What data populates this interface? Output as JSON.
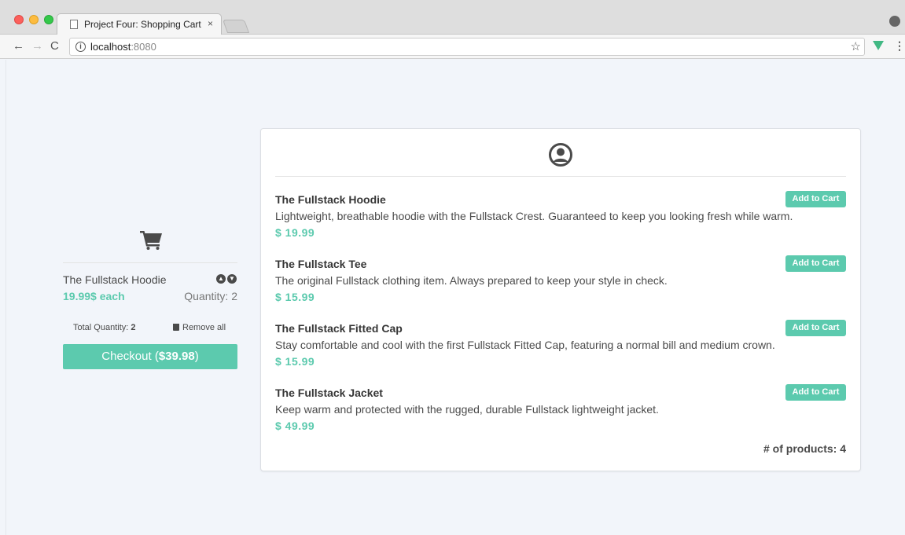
{
  "browser": {
    "tab_title": "Project Four: Shopping Cart",
    "tab_close": "×",
    "url_host": "localhost",
    "url_port": ":8080",
    "back_glyph": "←",
    "forward_glyph": "→",
    "reload_glyph": "C",
    "info_glyph": "i",
    "star_glyph": "☆",
    "menu_glyph": "⋮"
  },
  "cart": {
    "item_name": "The Fullstack Hoodie",
    "item_price": "19.99$ each",
    "item_quantity": "Quantity: 2",
    "total_quantity_label": "Total Quantity: ",
    "total_quantity_value": "2",
    "remove_all_label": "Remove all",
    "checkout_label": "Checkout (",
    "checkout_total": "$39.98",
    "checkout_close": ")"
  },
  "products": [
    {
      "title": "The Fullstack Hoodie",
      "description": "Lightweight, breathable hoodie with the Fullstack Crest. Guaranteed to keep you looking fresh while warm.",
      "price": "$ 19.99",
      "button": "Add to Cart"
    },
    {
      "title": "The Fullstack Tee",
      "description": "The original Fullstack clothing item. Always prepared to keep your style in check.",
      "price": "$ 15.99",
      "button": "Add to Cart"
    },
    {
      "title": "The Fullstack Fitted Cap",
      "description": "Stay comfortable and cool with the first Fullstack Fitted Cap, featuring a normal bill and medium crown.",
      "price": "$ 15.99",
      "button": "Add to Cart"
    },
    {
      "title": "The Fullstack Jacket",
      "description": "Keep warm and protected with the rugged, durable Fullstack lightweight jacket.",
      "price": "$ 49.99",
      "button": "Add to Cart"
    }
  ],
  "product_count_label": "# of products: 4",
  "icons": {
    "cart": "shopping-cart-icon",
    "user": "user-circle-icon",
    "trash": "trash-icon",
    "up": "arrow-circle-up-icon",
    "down": "arrow-circle-down-icon"
  },
  "colors": {
    "accent": "#5ccaae",
    "text": "#4a4a4a",
    "background": "#f2f5fa"
  }
}
